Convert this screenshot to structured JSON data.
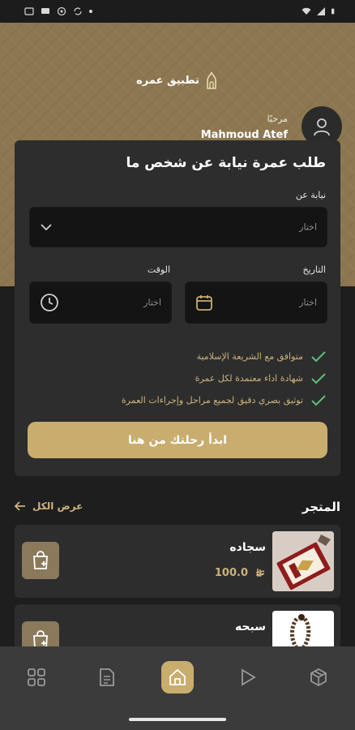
{
  "status_bar": {
    "time": "",
    "icons_left": [
      "sim-icon",
      "message-icon",
      "vpn-icon",
      "sync-icon"
    ],
    "icons_right": [
      "wifi-icon",
      "signal-icon",
      "battery-icon"
    ]
  },
  "header": {
    "app_name": "تطبيق عمره",
    "greeting": "مرحبًا",
    "user_name": "Mahmoud Atef"
  },
  "request_card": {
    "title": "طلب عمرة نيابة عن شخص ما",
    "on_behalf_label": "نيابة عن",
    "on_behalf_placeholder": "اختار",
    "date_label": "التاريخ",
    "date_placeholder": "اختار",
    "time_label": "الوقت",
    "time_placeholder": "اختار",
    "features": [
      "متوافق مع الشريعة الإسلامية",
      "شهادة اداء معتمدة لكل عمرة",
      "توثيق بصري دقيق لجميع مراحل وإجراءات العمرة"
    ],
    "cta_label": "ابدأ رحلتك من هنا"
  },
  "store": {
    "title": "المتجر",
    "view_all_label": "عرض الكل",
    "products": [
      {
        "name": "سجاده",
        "price": "100.0"
      },
      {
        "name": "سبحه",
        "price": ""
      }
    ]
  },
  "colors": {
    "accent": "#c9ad6f",
    "hero": "#8c7750",
    "card": "#2d2d2d",
    "background": "#1e1e1e",
    "nav": "#3b3b3b"
  },
  "bottom_nav": [
    "grid-icon",
    "document-icon",
    "home-icon",
    "play-icon",
    "box-icon"
  ]
}
